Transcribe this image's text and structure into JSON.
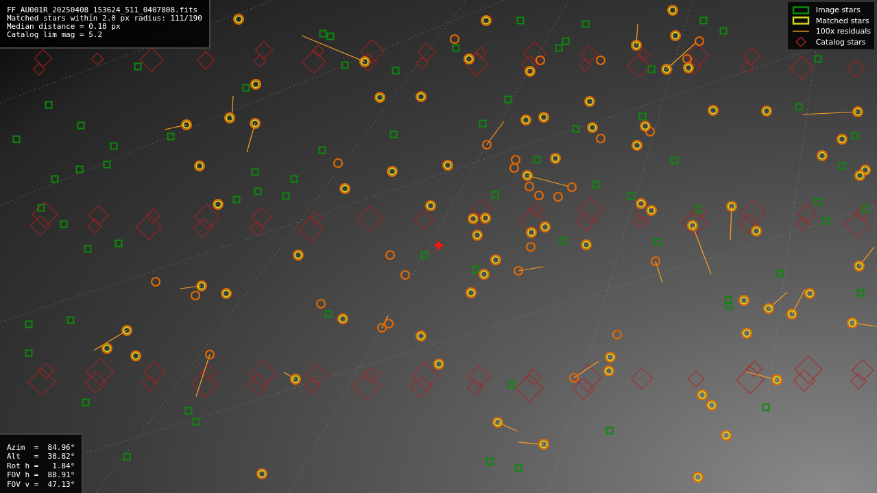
{
  "info_panel": {
    "lines": [
      "FF_AU001R_20250408_153624_511_0407808.fits",
      "Matched stars within 2.0 px radius: 111/190",
      "Median distance = 0.18 px",
      "Catalog lim mag = 5.2"
    ]
  },
  "legend": {
    "items": [
      {
        "kind": "image",
        "label": "Image stars"
      },
      {
        "kind": "matched",
        "label": "Matched stars"
      },
      {
        "kind": "residual",
        "label": "100x residuals"
      },
      {
        "kind": "catalog",
        "label": "Catalog stars"
      }
    ]
  },
  "pointing_panel": {
    "lines": [
      "Azim  =  84.96°",
      "Alt   =  38.82°",
      "Rot h =   1.84°",
      "FOV h =  88.91°",
      "FOV v =  47.13°"
    ]
  }
}
